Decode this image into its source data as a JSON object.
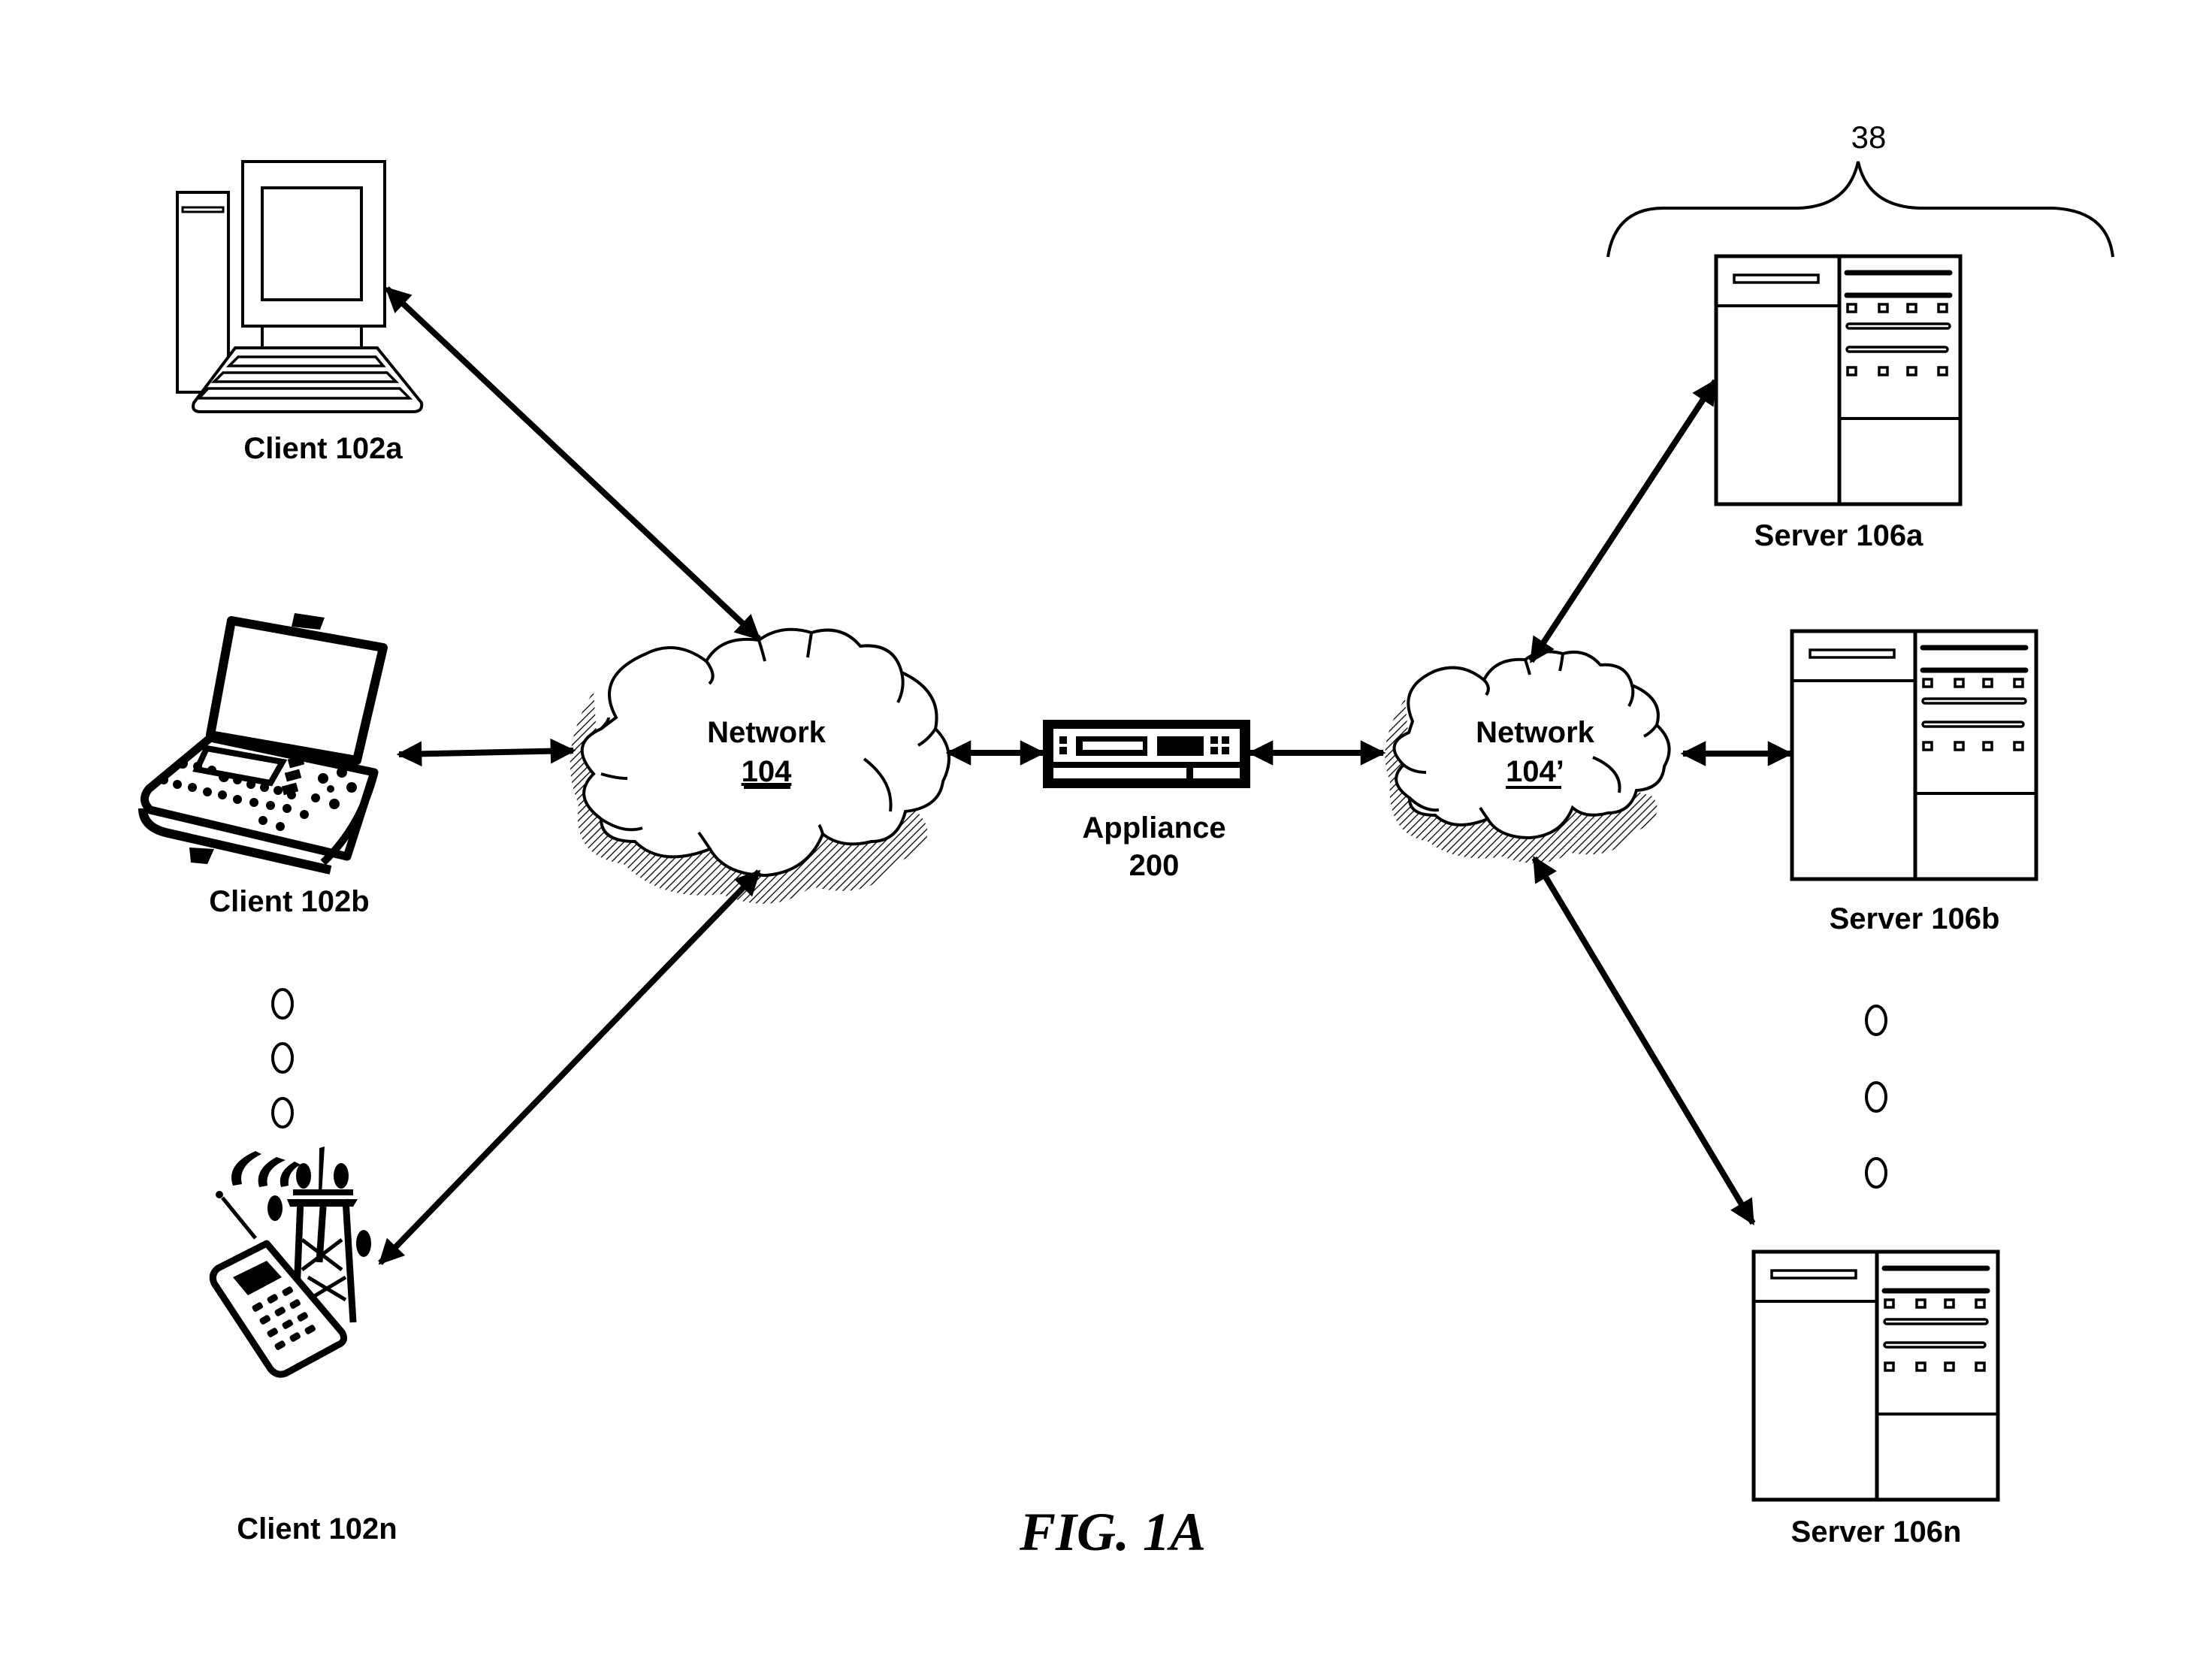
{
  "figure": {
    "caption": "FIG. 1A",
    "group_label": "38"
  },
  "clients": [
    {
      "id": "102a",
      "label": "Client 102a",
      "icon": "desktop-computer-icon"
    },
    {
      "id": "102b",
      "label": "Client 102b",
      "icon": "laptop-icon"
    },
    {
      "id": "102n",
      "label": "Client 102n",
      "icon": "mobile-phone-tower-icon"
    }
  ],
  "networks": [
    {
      "id": "104",
      "title": "Network",
      "number": "104",
      "icon": "cloud-icon"
    },
    {
      "id": "104p",
      "title": "Network",
      "number": "104’",
      "icon": "cloud-icon"
    }
  ],
  "appliance": {
    "title": "Appliance",
    "number": "200",
    "icon": "rack-appliance-icon"
  },
  "servers": [
    {
      "id": "106a",
      "label": "Server 106a",
      "icon": "server-icon"
    },
    {
      "id": "106b",
      "label": "Server 106b",
      "icon": "server-icon"
    },
    {
      "id": "106n",
      "label": "Server 106n",
      "icon": "server-icon"
    }
  ],
  "connections": [
    {
      "from": "Client 102a",
      "to": "Network 104",
      "type": "bidirectional"
    },
    {
      "from": "Client 102b",
      "to": "Network 104",
      "type": "bidirectional"
    },
    {
      "from": "Client 102n",
      "to": "Network 104",
      "type": "bidirectional"
    },
    {
      "from": "Network 104",
      "to": "Appliance 200",
      "type": "bidirectional"
    },
    {
      "from": "Appliance 200",
      "to": "Network 104’",
      "type": "bidirectional"
    },
    {
      "from": "Network 104’",
      "to": "Server 106a",
      "type": "bidirectional"
    },
    {
      "from": "Network 104’",
      "to": "Server 106b",
      "type": "bidirectional"
    },
    {
      "from": "Network 104’",
      "to": "Server 106n",
      "type": "bidirectional"
    }
  ],
  "ellipsis": {
    "clients": "vertical-ellipsis",
    "servers": "vertical-ellipsis"
  }
}
